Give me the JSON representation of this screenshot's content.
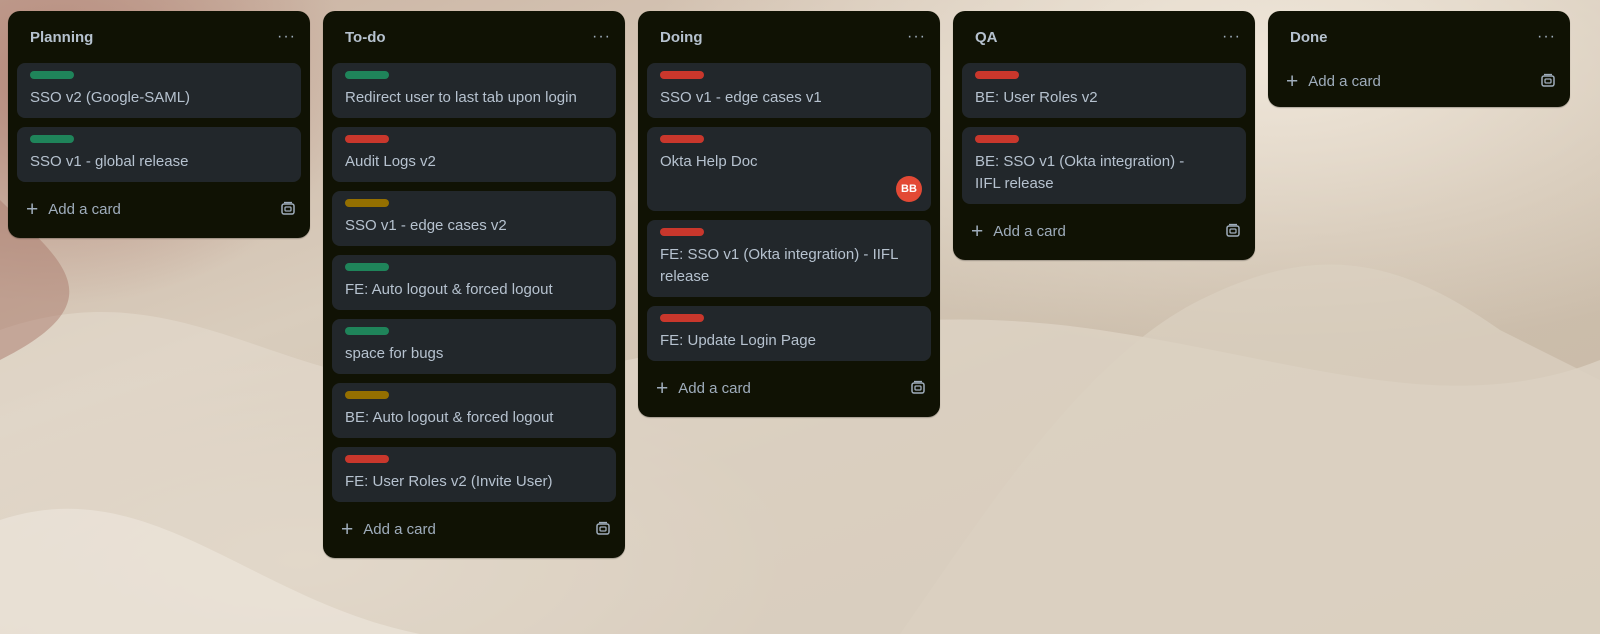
{
  "colors": {
    "green": "#1f845a",
    "red": "#c9372c",
    "yellow": "#946f00"
  },
  "add_card_label": "Add a card",
  "menu_glyph": "···",
  "lists": [
    {
      "title": "Planning",
      "cards": [
        {
          "label": "green",
          "title": "SSO v2 (Google-SAML)"
        },
        {
          "label": "green",
          "title": "SSO v1 - global release"
        }
      ]
    },
    {
      "title": "To-do",
      "cards": [
        {
          "label": "green",
          "title": "Redirect user to last tab upon login"
        },
        {
          "label": "red",
          "title": "Audit Logs v2"
        },
        {
          "label": "yellow",
          "title": "SSO v1 - edge cases v2"
        },
        {
          "label": "green",
          "title": "FE: Auto logout & forced logout"
        },
        {
          "label": "green",
          "title": "space for bugs"
        },
        {
          "label": "yellow",
          "title": "BE: Auto logout & forced logout"
        },
        {
          "label": "red",
          "title": "FE: User Roles v2 (Invite User)"
        }
      ]
    },
    {
      "title": "Doing",
      "cards": [
        {
          "label": "red",
          "title": "SSO v1 - edge cases v1"
        },
        {
          "label": "red",
          "title": "Okta Help Doc",
          "member": "BB"
        },
        {
          "label": "red",
          "title": "FE: SSO v1 (Okta integration) - IIFL release"
        },
        {
          "label": "red",
          "title": "FE: Update Login Page"
        }
      ]
    },
    {
      "title": "QA",
      "cards": [
        {
          "label": "red",
          "title": "BE: User Roles v2"
        },
        {
          "label": "red",
          "title": "BE: SSO v1 (Okta integration) - IIFL release"
        }
      ]
    },
    {
      "title": "Done",
      "cards": []
    }
  ]
}
